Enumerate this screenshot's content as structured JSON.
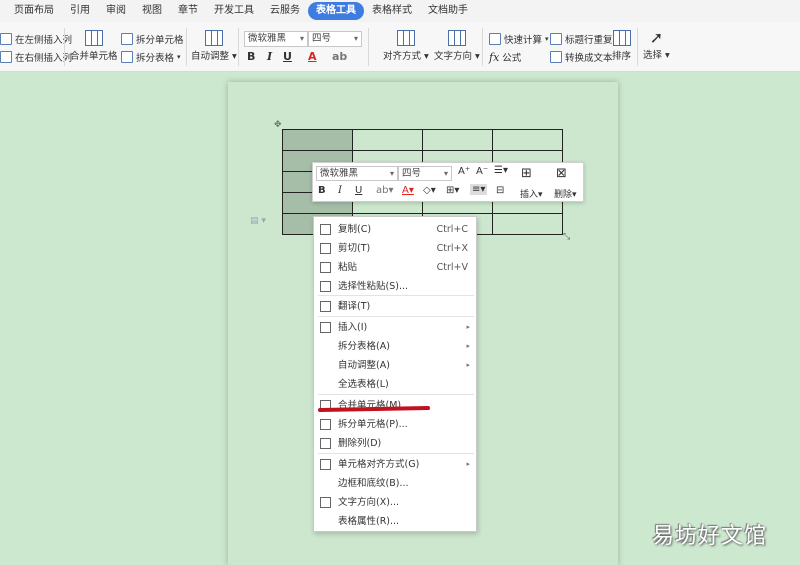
{
  "tabs": [
    "页面布局",
    "引用",
    "审阅",
    "视图",
    "章节",
    "开发工具",
    "云服务",
    "表格工具",
    "表格样式",
    "文档助手"
  ],
  "active_tab": "表格工具",
  "toolbar": {
    "insert_left": "在左侧插入列",
    "insert_right": "在右侧插入列",
    "merge_cells": "合并单元格",
    "split_cells": "拆分单元格",
    "split_table": "拆分表格",
    "auto_fit": "自动调整",
    "font": "微软雅黑",
    "font_size": "四号",
    "bold": "B",
    "italic": "I",
    "underline": "U",
    "font_color": "A",
    "align": "对齐方式",
    "text_direction": "文字方向",
    "quick_calc": "快速计算",
    "formula": "公式",
    "repeat_header": "标题行重复",
    "convert_text": "转换成文本",
    "sort": "排序",
    "select": "选择",
    "fx": "fx"
  },
  "mini_toolbar": {
    "font": "微软雅黑",
    "font_size": "四号",
    "grow": "A⁺",
    "shrink": "A⁻",
    "bold": "B",
    "italic": "I",
    "underline": "U",
    "insert": "插入",
    "delete": "删除"
  },
  "context_menu": [
    {
      "label": "复制(C)",
      "shortcut": "Ctrl+C"
    },
    {
      "label": "剪切(T)",
      "shortcut": "Ctrl+X"
    },
    {
      "label": "粘贴",
      "shortcut": "Ctrl+V"
    },
    {
      "label": "选择性粘贴(S)...",
      "shortcut": ""
    },
    {
      "label": "翻译(T)",
      "shortcut": ""
    },
    {
      "label": "插入(I)",
      "shortcut": ""
    },
    {
      "label": "拆分表格(A)",
      "shortcut": ""
    },
    {
      "label": "自动调整(A)",
      "shortcut": ""
    },
    {
      "label": "全选表格(L)",
      "shortcut": ""
    },
    {
      "label": "合并单元格(M)",
      "shortcut": ""
    },
    {
      "label": "拆分单元格(P)...",
      "shortcut": ""
    },
    {
      "label": "删除列(D)",
      "shortcut": ""
    },
    {
      "label": "单元格对齐方式(G)",
      "shortcut": ""
    },
    {
      "label": "边框和底纹(B)...",
      "shortcut": ""
    },
    {
      "label": "文字方向(X)...",
      "shortcut": ""
    },
    {
      "label": "表格属性(R)...",
      "shortcut": ""
    }
  ],
  "watermark": "易坊好文馆",
  "colors": {
    "accent": "#3f7ce0",
    "page": "#cde7cf",
    "selected_cell": "#a6bea8",
    "highlight": "#c0121f"
  }
}
